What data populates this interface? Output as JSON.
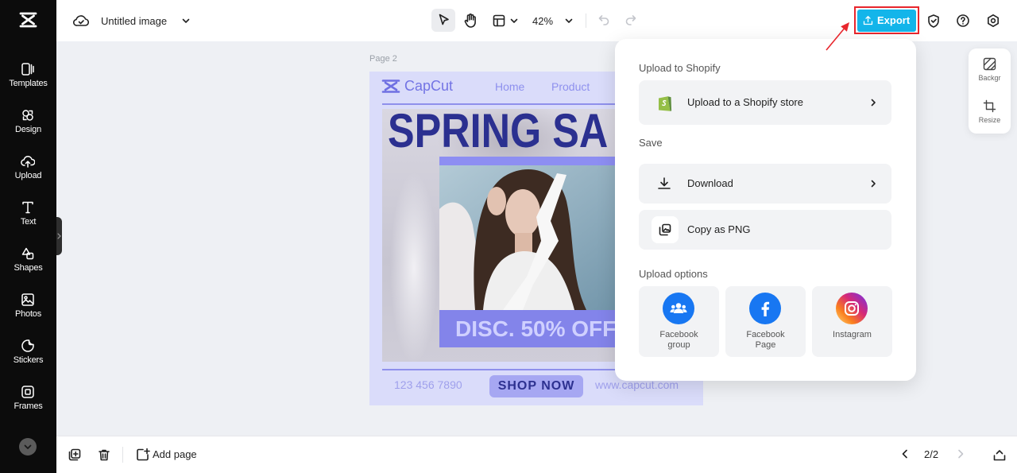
{
  "app": {
    "title": "Untitled image",
    "zoom": "42%",
    "export_label": "Export"
  },
  "colors": {
    "sidebar_bg": "#0c0c0c",
    "export_accent": "#13b5ea",
    "highlight_box": "#e8262d",
    "canvas_bg": "#eef0f4",
    "design_bg": "#dadcfa",
    "headline": "#2b3090"
  },
  "sidebar": {
    "items": [
      {
        "label": "Templates",
        "icon": "templates-icon"
      },
      {
        "label": "Design",
        "icon": "design-icon"
      },
      {
        "label": "Upload",
        "icon": "upload-icon"
      },
      {
        "label": "Text",
        "icon": "text-icon"
      },
      {
        "label": "Shapes",
        "icon": "shapes-icon"
      },
      {
        "label": "Photos",
        "icon": "photos-icon"
      },
      {
        "label": "Stickers",
        "icon": "stickers-icon"
      },
      {
        "label": "Frames",
        "icon": "frames-icon"
      }
    ]
  },
  "right_panel": {
    "items": [
      {
        "label": "Backgr",
        "icon": "background-icon"
      },
      {
        "label": "Resize",
        "icon": "resize-icon"
      }
    ]
  },
  "canvas": {
    "page_label": "Page 2",
    "design": {
      "brand": "CapCut",
      "nav": [
        "Home",
        "Product"
      ],
      "headline": "SPRING SA",
      "discount": "DISC. 50% OFF",
      "phone": "123 456 7890",
      "cta": "SHOP NOW",
      "website": "www.capcut.com"
    }
  },
  "export_menu": {
    "shopify_heading": "Upload to Shopify",
    "shopify_item": "Upload to a Shopify store",
    "save_heading": "Save",
    "download": "Download",
    "copy_png": "Copy as PNG",
    "upload_heading": "Upload options",
    "upload_options": [
      {
        "label": "Facebook group",
        "icon": "facebook-group-icon"
      },
      {
        "label": "Facebook Page",
        "icon": "facebook-icon"
      },
      {
        "label": "Instagram",
        "icon": "instagram-icon"
      }
    ]
  },
  "bottom_bar": {
    "add_page": "Add page",
    "page_indicator": "2/2"
  }
}
